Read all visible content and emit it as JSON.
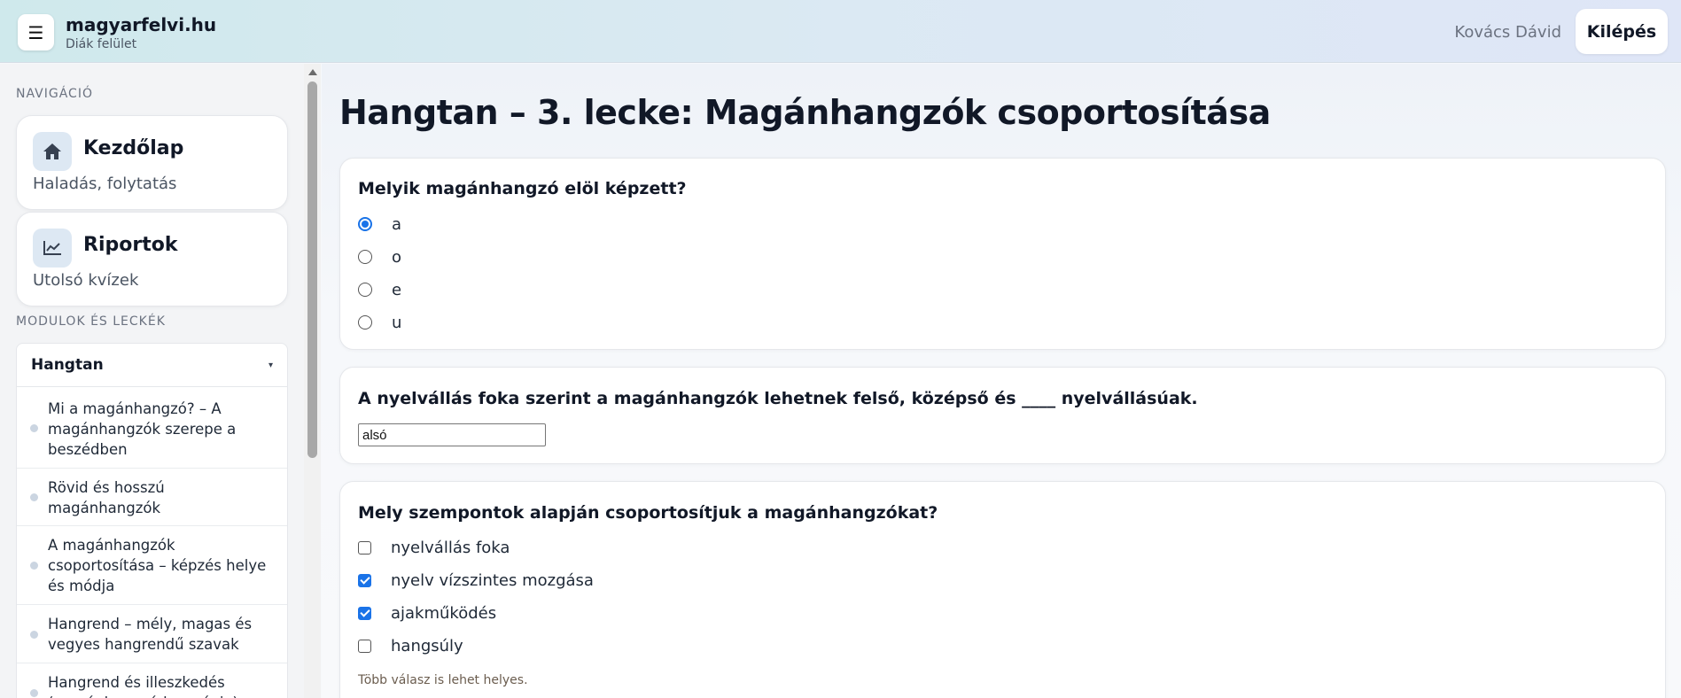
{
  "header": {
    "menu_icon": "☰",
    "brand": "magyarfelvi.hu",
    "subtitle": "Diák felület",
    "user": "Kovács Dávid",
    "logout": "Kilépés"
  },
  "sidebar": {
    "nav_label": "NAVIGÁCIÓ",
    "nav_items": [
      {
        "title": "Kezdőlap",
        "sub": "Haladás, folytatás",
        "icon": "home-icon"
      },
      {
        "title": "Riportok",
        "sub": "Utolsó kvízek",
        "icon": "chart-icon"
      }
    ],
    "modules_label": "MODULOK ÉS LECKÉK",
    "module": {
      "title": "Hangtan",
      "caret": "▾",
      "lessons": [
        "Mi a magánhangzó? – A magánhangzók szerepe a beszédben",
        "Rövid és hosszú magánhangzók",
        "A magánhangzók csoportosítása – képzés helye és módja",
        "Hangrend – mély, magas és vegyes hangrendű szavak",
        "Hangrend és illeszkedés (magánhangzó-harmónia)"
      ]
    }
  },
  "main": {
    "title": "Hangtan – 3. lecke: Magánhangzók csoportosítása",
    "q1": {
      "text": "Melyik magánhangzó elöl képzett?",
      "options": [
        "a",
        "o",
        "e",
        "u"
      ],
      "selected": 0
    },
    "q2": {
      "text": "A nyelvállás foka szerint a magánhangzók lehetnek felső, középső és ____ nyelvállásúak.",
      "value": "alsó"
    },
    "q3": {
      "text": "Mely szempontok alapján csoportosítjuk a magánhangzókat?",
      "options": [
        "nyelvállás foka",
        "nyelv vízszintes mozgása",
        "ajakműködés",
        "hangsúly"
      ],
      "checked": [
        false,
        true,
        true,
        false
      ],
      "hint": "Több válasz is lehet helyes."
    }
  },
  "colors": {
    "accent": "#1a73e8",
    "icon_bg": "#dde8f3"
  }
}
